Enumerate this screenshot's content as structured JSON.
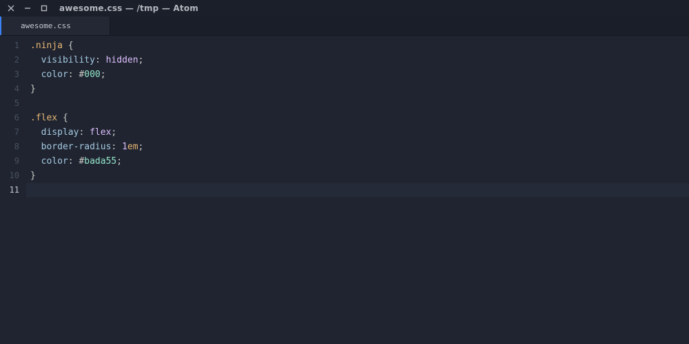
{
  "window": {
    "title": "awesome.css — /tmp — Atom"
  },
  "tabs": [
    {
      "label": "awesome.css",
      "active": true
    }
  ],
  "gutter": {
    "lines": [
      "1",
      "2",
      "3",
      "4",
      "5",
      "6",
      "7",
      "8",
      "9",
      "10",
      "11"
    ],
    "current_line_index": 10
  },
  "code": {
    "indent": "  ",
    "lines": [
      {
        "type": "selector-open",
        "selector": ".ninja"
      },
      {
        "type": "decl",
        "prop": "visibility",
        "kind": "keyword",
        "value": "hidden"
      },
      {
        "type": "decl",
        "prop": "color",
        "kind": "hex",
        "value": "000"
      },
      {
        "type": "close"
      },
      {
        "type": "blank"
      },
      {
        "type": "selector-open",
        "selector": ".flex"
      },
      {
        "type": "decl",
        "prop": "display",
        "kind": "keyword",
        "value": "flex"
      },
      {
        "type": "decl",
        "prop": "border-radius",
        "kind": "number-unit",
        "number": "1",
        "unit": "em"
      },
      {
        "type": "decl",
        "prop": "color",
        "kind": "hex",
        "value": "bada55"
      },
      {
        "type": "close"
      },
      {
        "type": "blank",
        "current": true
      }
    ]
  }
}
